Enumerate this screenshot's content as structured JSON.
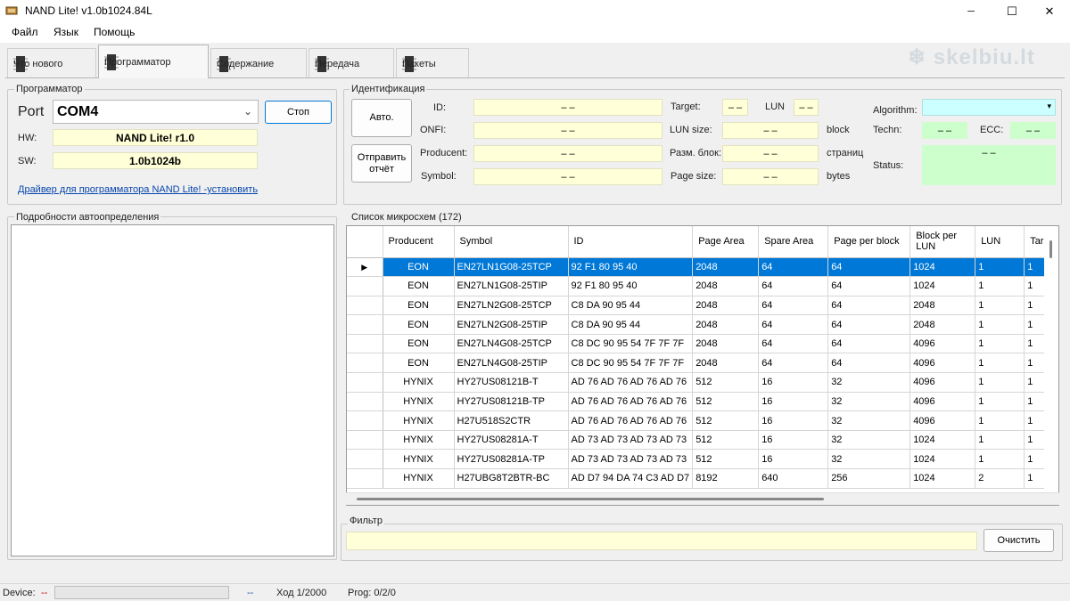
{
  "window": {
    "title": "NAND Lite! v1.0b1024.84L",
    "minimize_glyph": "─",
    "maximize_glyph": "☐",
    "close_glyph": "✕"
  },
  "watermark": "skelbiu.lt",
  "menu": [
    "Файл",
    "Язык",
    "Помощь"
  ],
  "tabs": [
    "Что нового",
    "Программатор",
    "Содержание",
    "Передача",
    "Пакеты"
  ],
  "programmer": {
    "title": "Программатор",
    "port_label": "Port",
    "port_value": "COM4",
    "stop_button": "Стоп",
    "hw_label": "HW:",
    "hw_value": "NAND Lite! r1.0",
    "sw_label": "SW:",
    "sw_value": "1.0b1024b",
    "driver_link": "Драйвер для программатора NAND Lite! -установить"
  },
  "identification": {
    "title": "Идентификация",
    "auto_button": "Авто.",
    "report_button_line1": "Отправить",
    "report_button_line2": "отчёт",
    "id_label": "ID:",
    "onfi_label": "ONFI:",
    "producent_label": "Producent:",
    "symbol_label": "Symbol:",
    "empty_value": "– –",
    "target_label": "Target:",
    "lun_label": "LUN",
    "lun_size_label": "LUN size:",
    "block_size_label": "Разм. блок:",
    "page_size_label": "Page size:",
    "unit_block": "block",
    "unit_pages": "страниц",
    "unit_bytes": "bytes",
    "algorithm_label": "Algorithm:",
    "techn_label": "Techn:",
    "ecc_label": "ECC:",
    "status_label": "Status:"
  },
  "autodetect": {
    "title": "Подробности автоопределения"
  },
  "chip_list": {
    "title": "Список микросхем (172)",
    "columns": [
      "Producent",
      "Symbol",
      "ID",
      "Page Area",
      "Spare Area",
      "Page per block",
      "Block per LUN",
      "LUN",
      "Tar"
    ],
    "rows": [
      [
        "EON",
        "EN27LN1G08-25TCP",
        "92 F1 80 95 40",
        "2048",
        "64",
        "64",
        "1024",
        "1",
        "1"
      ],
      [
        "EON",
        "EN27LN1G08-25TIP",
        "92 F1 80 95 40",
        "2048",
        "64",
        "64",
        "1024",
        "1",
        "1"
      ],
      [
        "EON",
        "EN27LN2G08-25TCP",
        "C8 DA 90 95 44",
        "2048",
        "64",
        "64",
        "2048",
        "1",
        "1"
      ],
      [
        "EON",
        "EN27LN2G08-25TIP",
        "C8 DA 90 95 44",
        "2048",
        "64",
        "64",
        "2048",
        "1",
        "1"
      ],
      [
        "EON",
        "EN27LN4G08-25TCP",
        "C8 DC 90 95 54 7F 7F 7F",
        "2048",
        "64",
        "64",
        "4096",
        "1",
        "1"
      ],
      [
        "EON",
        "EN27LN4G08-25TIP",
        "C8 DC 90 95 54 7F 7F 7F",
        "2048",
        "64",
        "64",
        "4096",
        "1",
        "1"
      ],
      [
        "HYNIX",
        "HY27US08121B-T",
        "AD 76 AD 76 AD 76 AD 76",
        "512",
        "16",
        "32",
        "4096",
        "1",
        "1"
      ],
      [
        "HYNIX",
        "HY27US08121B-TP",
        "AD 76 AD 76 AD 76 AD 76",
        "512",
        "16",
        "32",
        "4096",
        "1",
        "1"
      ],
      [
        "HYNIX",
        "H27U518S2CTR",
        "AD 76 AD 76 AD 76 AD 76",
        "512",
        "16",
        "32",
        "4096",
        "1",
        "1"
      ],
      [
        "HYNIX",
        "HY27US08281A-T",
        "AD 73 AD 73 AD 73 AD 73",
        "512",
        "16",
        "32",
        "1024",
        "1",
        "1"
      ],
      [
        "HYNIX",
        "HY27US08281A-TP",
        "AD 73 AD 73 AD 73 AD 73",
        "512",
        "16",
        "32",
        "1024",
        "1",
        "1"
      ],
      [
        "HYNIX",
        "H27UBG8T2BTR-BC",
        "AD D7 94 DA 74 C3 AD D7",
        "8192",
        "640",
        "256",
        "1024",
        "2",
        "1"
      ]
    ],
    "selected_row": 0
  },
  "filter": {
    "title": "Фильтр",
    "value": "",
    "clear_button": "Очистить"
  },
  "status": {
    "device_label": "Device:",
    "device_value": "--",
    "sep_value": "--",
    "step_text": "Ход 1/2000",
    "prog_text": "Prog: 0/2/0"
  },
  "colors": {
    "selection": "#0078d7",
    "yellow_field": "#ffffd8",
    "cyan_field": "#ccffff",
    "green_field": "#ccffcc",
    "device_value_red": "#cc0000"
  }
}
